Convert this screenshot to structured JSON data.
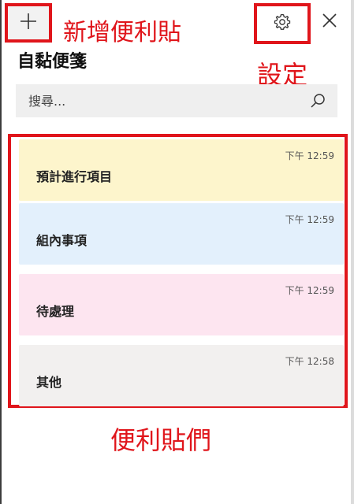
{
  "header": {
    "add_icon": "plus-icon",
    "settings_icon": "gear-icon",
    "close_icon": "close-icon"
  },
  "annotations": {
    "add_note": "新增便利貼",
    "settings": "設定",
    "notes": "便利貼們",
    "color": "#e0151b"
  },
  "app": {
    "title": "自黏便箋"
  },
  "search": {
    "placeholder": "搜尋...",
    "icon": "search-icon"
  },
  "notes": [
    {
      "title": "預計進行項目",
      "time": "下午 12:59",
      "color": "#fdf5cc"
    },
    {
      "title": "組內事項",
      "time": "下午 12:59",
      "color": "#e3f0fc"
    },
    {
      "title": "待處理",
      "time": "下午 12:59",
      "color": "#fde5f0"
    },
    {
      "title": "其他",
      "time": "下午 12:58",
      "color": "#f2f0ef"
    }
  ]
}
